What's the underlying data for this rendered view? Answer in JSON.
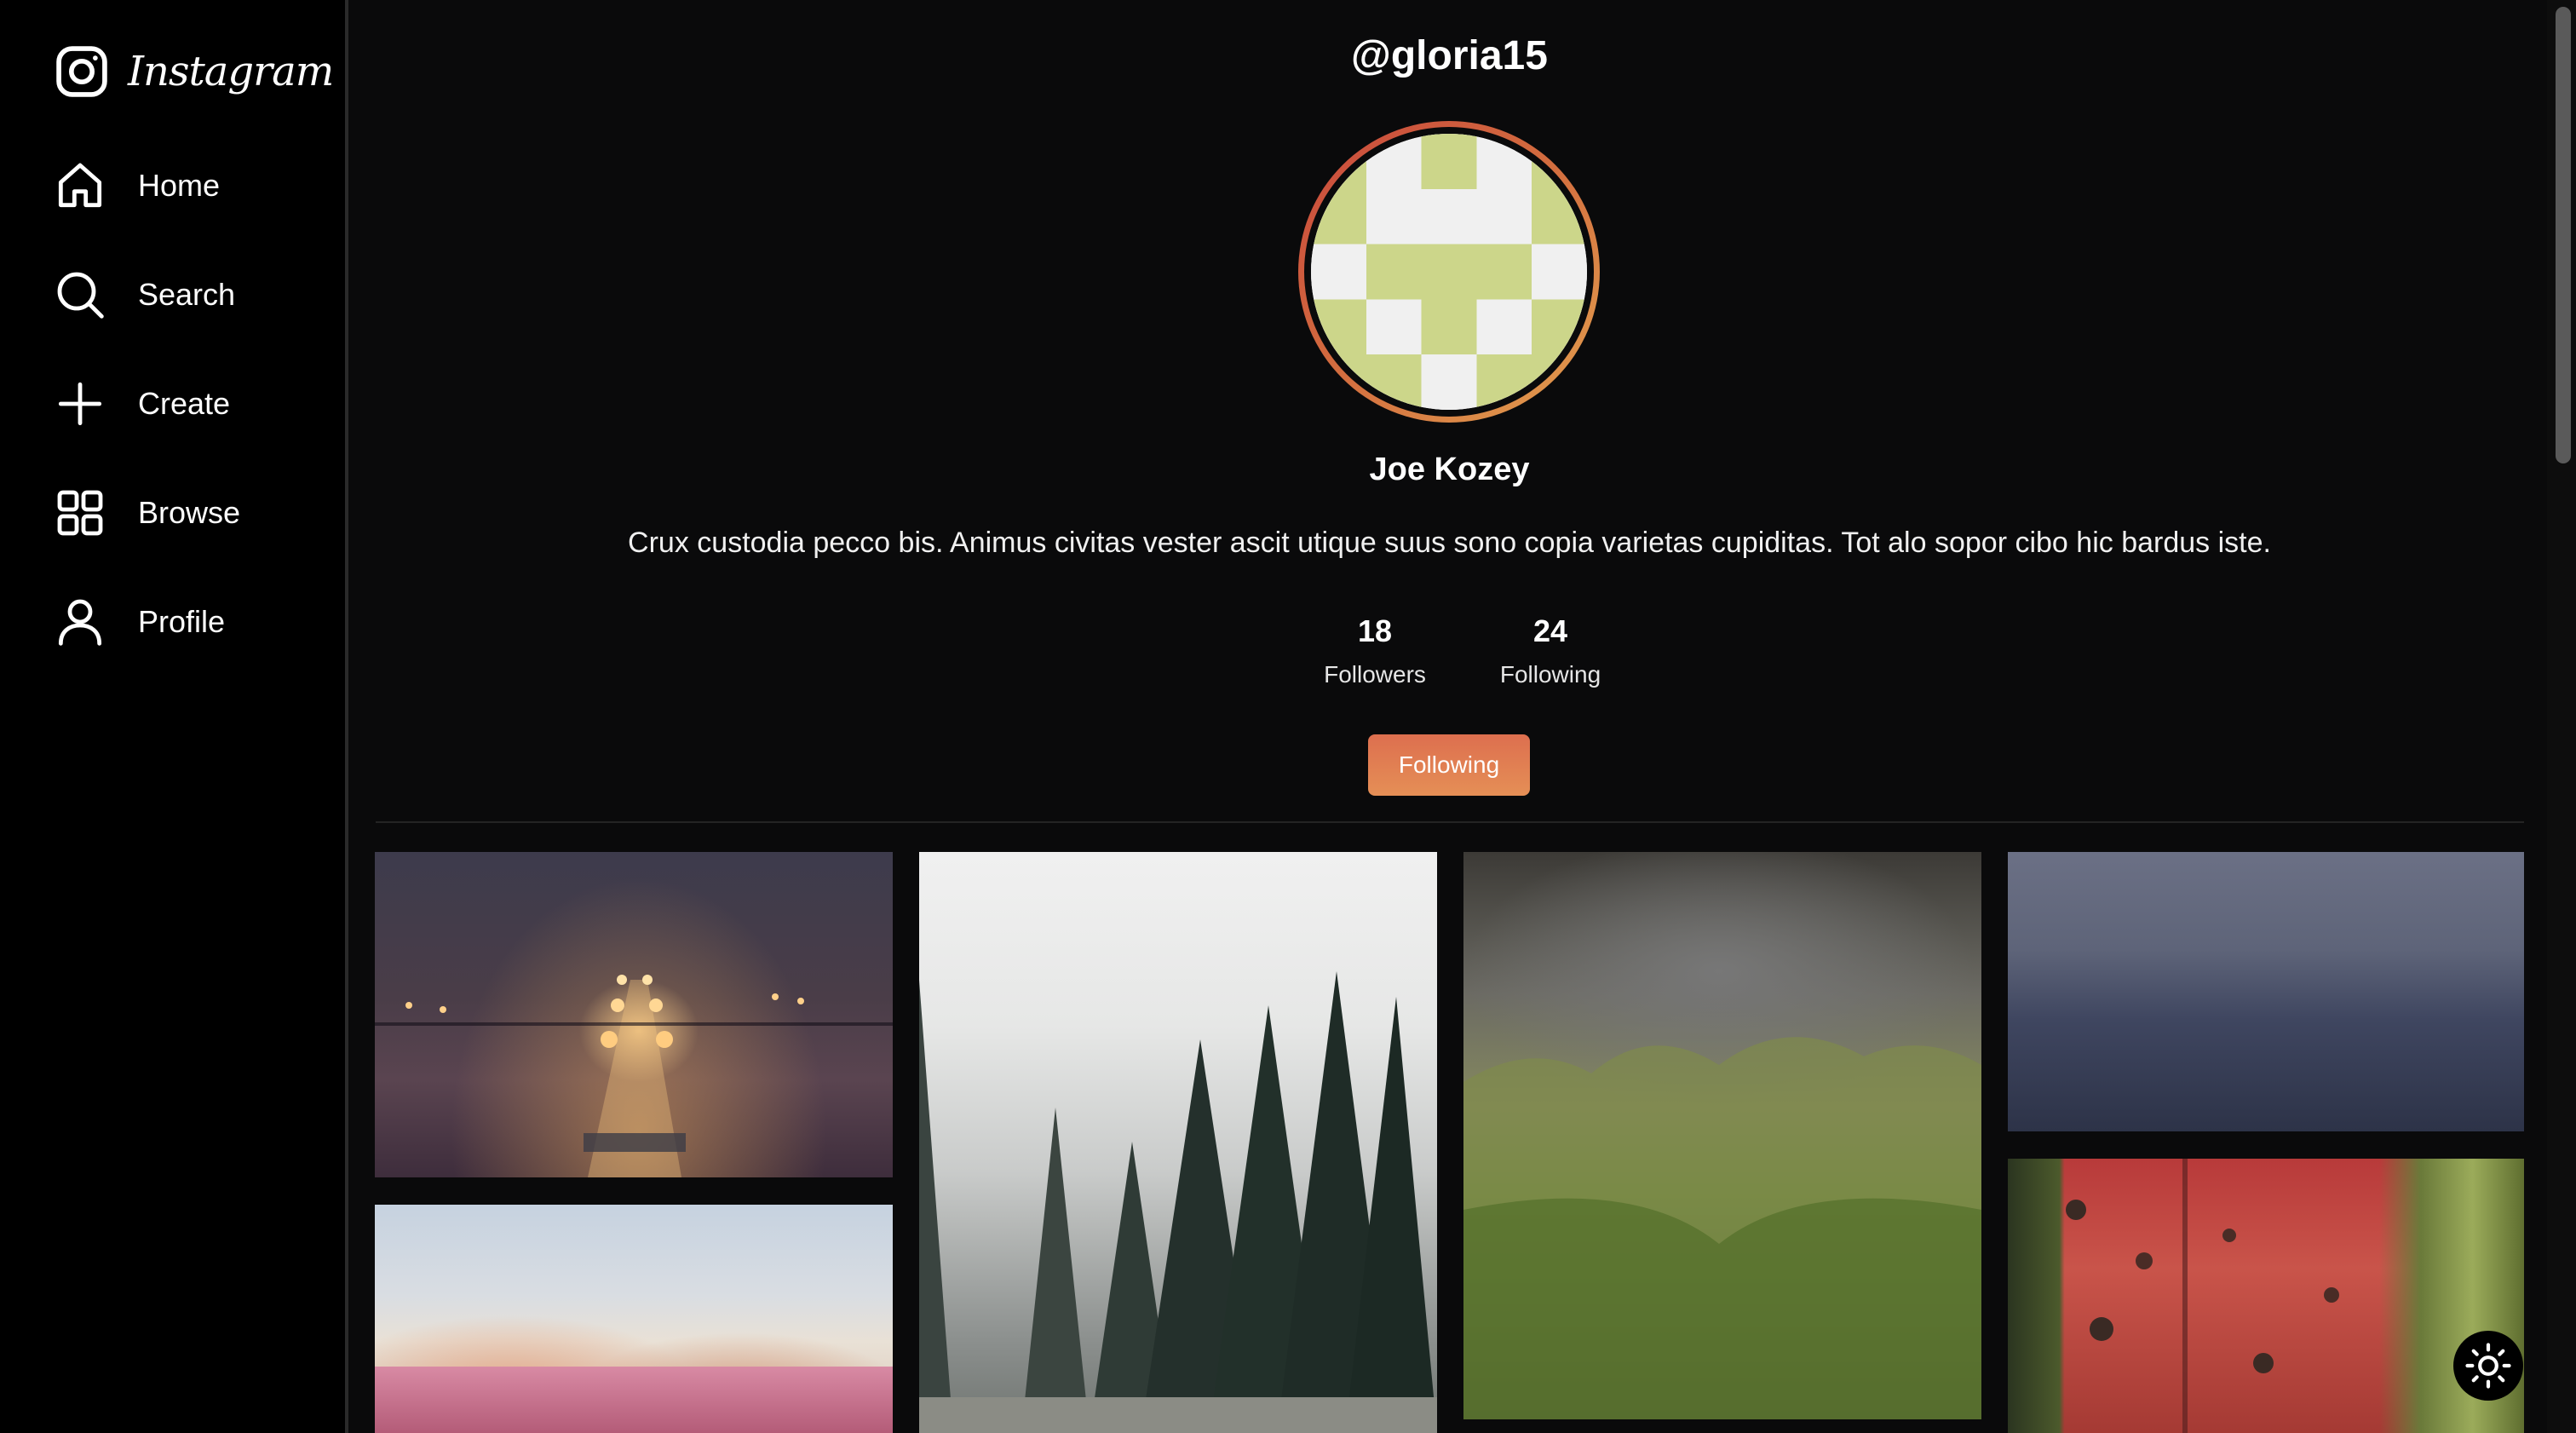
{
  "app": {
    "brand": "Instagram"
  },
  "sidebar": {
    "items": [
      {
        "label": "Home",
        "icon": "home-icon"
      },
      {
        "label": "Search",
        "icon": "search-icon"
      },
      {
        "label": "Create",
        "icon": "plus-icon"
      },
      {
        "label": "Browse",
        "icon": "grid-icon"
      },
      {
        "label": "Profile",
        "icon": "user-icon"
      }
    ]
  },
  "profile": {
    "handle": "@gloria15",
    "name": "Joe Kozey",
    "bio": "Crux custodia pecco bis. Animus civitas vester ascit utique suus sono copia varietas cupiditas. Tot alo sopor cibo hic bardus iste.",
    "followers_count": "18",
    "followers_label": "Followers",
    "following_count": "24",
    "following_label": "Following",
    "follow_button": "Following"
  },
  "colors": {
    "background": "#0a0a0b",
    "sidebar": "#000000",
    "accent_gradient_start": "#dd6f4f",
    "accent_gradient_end": "#e58f56",
    "avatar_pattern": "#ccd68a"
  },
  "posts": [
    {
      "subject": "foggy train station at night"
    },
    {
      "subject": "people sunbathing on beach"
    },
    {
      "subject": "misty pine forest and road"
    },
    {
      "subject": "green mountain valley under clouds"
    },
    {
      "subject": "misty grey sea"
    },
    {
      "subject": "rusty red barrel"
    }
  ]
}
